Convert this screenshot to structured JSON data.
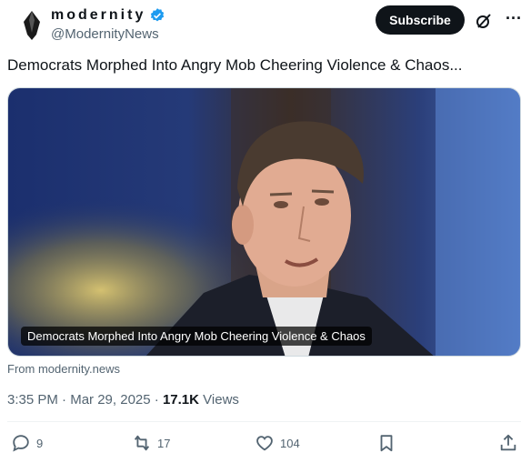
{
  "header": {
    "display_name": "modernity",
    "handle": "@ModernityNews",
    "subscribe_label": "Subscribe",
    "more_label": "···"
  },
  "post": {
    "text": "Democrats Morphed Into Angry Mob Cheering Violence & Chaos...",
    "media_caption": "Democrats Morphed Into Angry Mob Cheering Violence & Chaos",
    "source": "From modernity.news"
  },
  "meta": {
    "time": "3:35 PM",
    "date": "Mar 29, 2025",
    "views_count": "17.1K",
    "views_label": "Views",
    "sep": "·"
  },
  "actions": {
    "replies": "9",
    "reposts": "17",
    "likes": "104"
  },
  "colors": {
    "verified": "#1d9bf0",
    "text_primary": "#0f1419",
    "text_secondary": "#536471"
  },
  "icons": [
    "verified-badge-icon",
    "grok-icon",
    "more-icon",
    "reply-icon",
    "repost-icon",
    "like-icon",
    "bookmark-icon",
    "share-icon"
  ]
}
